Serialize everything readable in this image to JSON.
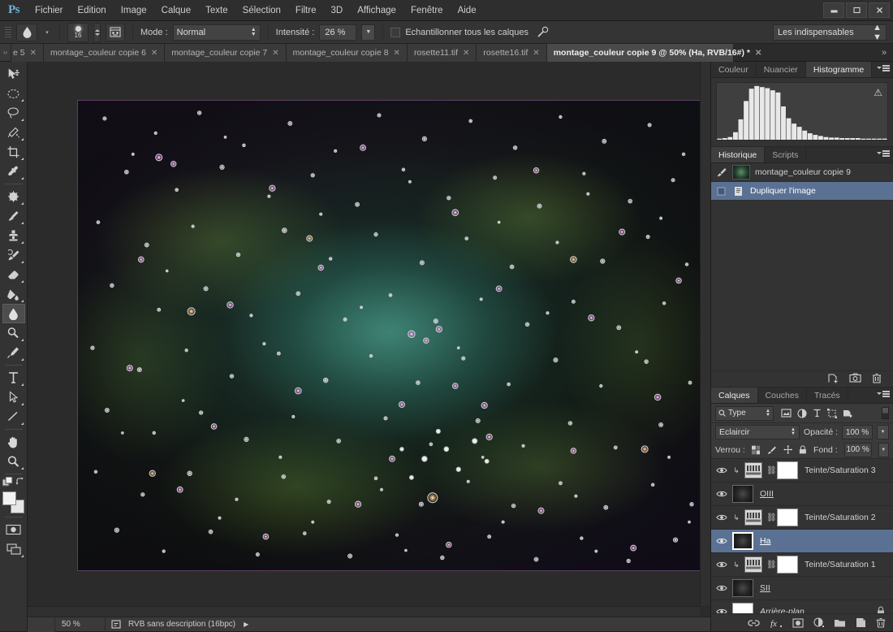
{
  "app": {
    "name": "Ps",
    "menu": [
      "Fichier",
      "Edition",
      "Image",
      "Calque",
      "Texte",
      "Sélection",
      "Filtre",
      "3D",
      "Affichage",
      "Fenêtre",
      "Aide"
    ],
    "window_controls": [
      "minimize-button",
      "maximize-button",
      "close-button"
    ]
  },
  "options_bar": {
    "tool_icon": "blur-droplet-icon",
    "brush_size": "16",
    "brush_panel_icon": "brush-panel-icon",
    "mode_label": "Mode :",
    "mode_value": "Normal",
    "strength_label": "Intensité :",
    "strength_value": "26 %",
    "sample_all_layers_label": "Echantillonner tous les calques",
    "sample_all_layers_checked": false,
    "airbrush_icon": "airbrush-icon",
    "workspace": "Les indispensables"
  },
  "tabs": [
    {
      "label": "e 5",
      "active": false,
      "truncated": true
    },
    {
      "label": "montage_couleur copie 6",
      "active": false
    },
    {
      "label": "montage_couleur copie 7",
      "active": false
    },
    {
      "label": "montage_couleur copie 8",
      "active": false
    },
    {
      "label": "rosette11.tif",
      "active": false
    },
    {
      "label": "rosette16.tif",
      "active": false
    },
    {
      "label": "montage_couleur copie 9 @ 50% (Ha, RVB/16#) *",
      "active": true
    }
  ],
  "tab_overflow": "»",
  "toolbar": {
    "tools": [
      {
        "name": "move-tool",
        "selected": false
      },
      {
        "name": "marquee-tool",
        "selected": false
      },
      {
        "name": "lasso-tool",
        "selected": false
      },
      {
        "name": "quick-selection-tool",
        "selected": false
      },
      {
        "name": "crop-tool",
        "selected": false
      },
      {
        "name": "eyedropper-tool",
        "selected": false
      },
      {
        "name": "spot-healing-tool",
        "selected": false
      },
      {
        "name": "brush-tool",
        "selected": false
      },
      {
        "name": "clone-stamp-tool",
        "selected": false
      },
      {
        "name": "history-brush-tool",
        "selected": false
      },
      {
        "name": "eraser-tool",
        "selected": false
      },
      {
        "name": "gradient-tool",
        "selected": false
      },
      {
        "name": "blur-tool",
        "selected": true
      },
      {
        "name": "dodge-tool",
        "selected": false
      },
      {
        "name": "pen-tool",
        "selected": false
      },
      {
        "name": "type-tool",
        "selected": false
      },
      {
        "name": "path-selection-tool",
        "selected": false
      },
      {
        "name": "line-tool",
        "selected": false
      },
      {
        "name": "hand-tool",
        "selected": false
      },
      {
        "name": "zoom-tool",
        "selected": false
      }
    ],
    "foreground_color": "#f2f2f2",
    "background_color": "#e6e6e6"
  },
  "document": {
    "zoom": "50 %",
    "color_mode": "RVB sans description (16bpc)",
    "canvas_border_color": "#5b4060"
  },
  "color_panel": {
    "tabs": [
      "Couleur",
      "Nuancier",
      "Histogramme"
    ],
    "active_tab": "Histogramme",
    "warning_icon": "histogram-warning-icon"
  },
  "chart_data": {
    "type": "bar",
    "title": "Histogramme",
    "xlabel": "",
    "ylabel": "",
    "categories": [
      "0",
      "8",
      "16",
      "24",
      "32",
      "40",
      "48",
      "56",
      "64",
      "72",
      "80",
      "88",
      "96",
      "104",
      "112",
      "120",
      "128",
      "136",
      "144",
      "152",
      "160",
      "168",
      "176",
      "184",
      "192",
      "200",
      "208",
      "216",
      "224",
      "232",
      "240",
      "248"
    ],
    "values": [
      2,
      3,
      5,
      14,
      38,
      72,
      95,
      100,
      98,
      96,
      92,
      88,
      62,
      40,
      30,
      24,
      17,
      12,
      9,
      7,
      5,
      4,
      4,
      3,
      3,
      3,
      3,
      2,
      2,
      2,
      2,
      2
    ],
    "ylim": [
      0,
      100
    ],
    "grid": false,
    "legend": false
  },
  "history_panel": {
    "tabs": [
      "Historique",
      "Scripts"
    ],
    "active_tab": "Historique",
    "items": [
      {
        "label": "montage_couleur copie 9",
        "icon": "snapshot-thumbnail",
        "selected": false
      },
      {
        "label": "Dupliquer l'image",
        "icon": "duplicate-image-icon",
        "selected": true
      }
    ],
    "buttons": [
      "new-document-from-state-button",
      "new-snapshot-button",
      "delete-state-button"
    ]
  },
  "layers_panel": {
    "tabs": [
      "Calques",
      "Couches",
      "Tracés"
    ],
    "active_tab": "Calques",
    "filter_label": "Type",
    "filter_icons": [
      "pixel-filter-icon",
      "adjustment-filter-icon",
      "type-filter-icon",
      "shape-filter-icon",
      "smart-object-filter-icon"
    ],
    "blend_mode": "Eclaircir",
    "opacity_label": "Opacité :",
    "opacity_value": "100 %",
    "lock_label": "Verrou :",
    "lock_icons": [
      "lock-transparency-icon",
      "lock-image-icon",
      "lock-position-icon",
      "lock-all-icon"
    ],
    "fill_label": "Fond :",
    "fill_value": "100 %",
    "layers": [
      {
        "name": "Teinte/Saturation 3",
        "type": "adjustment",
        "visible": true,
        "selected": false,
        "clipped": true,
        "locked": false,
        "italic": false,
        "underline": false
      },
      {
        "name": "OIII",
        "type": "image",
        "visible": true,
        "selected": false,
        "clipped": false,
        "locked": false,
        "italic": false,
        "underline": true
      },
      {
        "name": "Teinte/Saturation 2",
        "type": "adjustment",
        "visible": true,
        "selected": false,
        "clipped": true,
        "locked": false,
        "italic": false,
        "underline": false
      },
      {
        "name": "Ha",
        "type": "image",
        "visible": true,
        "selected": true,
        "clipped": false,
        "locked": false,
        "italic": false,
        "underline": true
      },
      {
        "name": "Teinte/Saturation 1",
        "type": "adjustment",
        "visible": true,
        "selected": false,
        "clipped": true,
        "locked": false,
        "italic": false,
        "underline": false
      },
      {
        "name": "SII",
        "type": "image",
        "visible": true,
        "selected": false,
        "clipped": false,
        "locked": false,
        "italic": false,
        "underline": true
      },
      {
        "name": "Arrière-plan",
        "type": "white",
        "visible": true,
        "selected": false,
        "clipped": false,
        "locked": true,
        "italic": true,
        "underline": false
      }
    ],
    "buttons": [
      "link-layers-button",
      "layer-style-button",
      "add-mask-button",
      "new-adjustment-button",
      "new-group-button",
      "new-layer-button",
      "delete-layer-button"
    ]
  }
}
